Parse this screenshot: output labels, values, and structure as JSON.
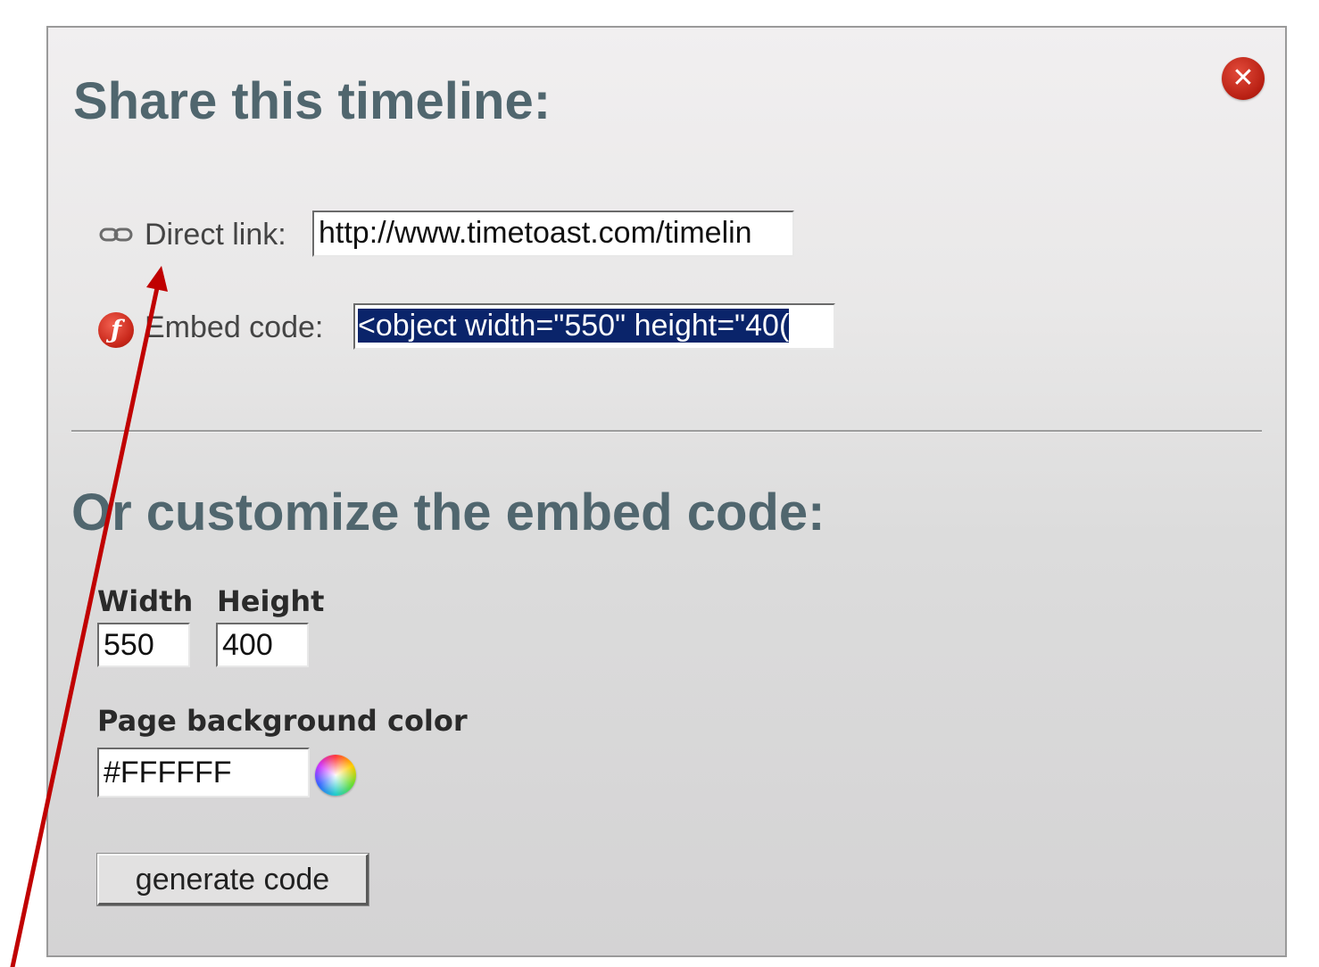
{
  "dialog": {
    "title": "Share this timeline:",
    "close_icon": "close-icon",
    "direct_link": {
      "icon": "link-icon",
      "label": "Direct link:",
      "value": "http://www.timetoast.com/timelin"
    },
    "embed_code": {
      "icon": "flash-icon",
      "label": "Embed code:",
      "value": "<object width=\"550\" height=\"40("
    },
    "customize": {
      "title": "Or customize the embed code:",
      "width_label": "Width",
      "width_value": "550",
      "height_label": "Height",
      "height_value": "400",
      "bg_color_label": "Page background color",
      "bg_color_value": "#FFFFFF",
      "color_picker_icon": "color-wheel-icon",
      "generate_button": "generate code"
    }
  },
  "annotation": {
    "arrow_color": "#c00000"
  },
  "colors": {
    "heading": "#50666e",
    "selection": "#0a246a",
    "close_red": "#b71f12"
  }
}
